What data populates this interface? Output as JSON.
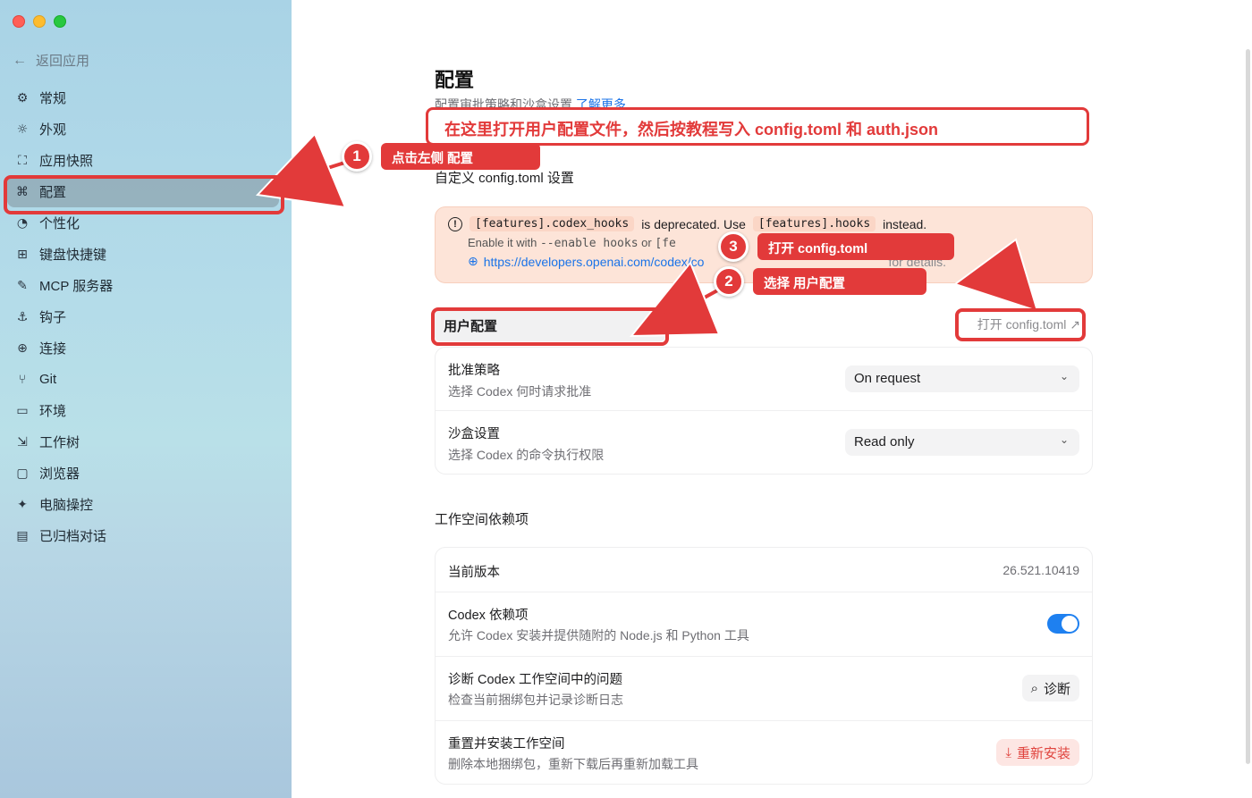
{
  "sidebar": {
    "back_label": "返回应用",
    "items": [
      {
        "label": "常规",
        "icon": "⚙"
      },
      {
        "label": "外观",
        "icon": "☼"
      },
      {
        "label": "应用快照",
        "icon": "⛶"
      },
      {
        "label": "配置",
        "icon": "⌘"
      },
      {
        "label": "个性化",
        "icon": "◔"
      },
      {
        "label": "键盘快捷键",
        "icon": "⊞"
      },
      {
        "label": "MCP 服务器",
        "icon": "✎"
      },
      {
        "label": "钩子",
        "icon": "⚓"
      },
      {
        "label": "连接",
        "icon": "⊕"
      },
      {
        "label": "Git",
        "icon": "⑂"
      },
      {
        "label": "环境",
        "icon": "▭"
      },
      {
        "label": "工作树",
        "icon": "⇲"
      },
      {
        "label": "浏览器",
        "icon": "▢"
      },
      {
        "label": "电脑操控",
        "icon": "✦"
      },
      {
        "label": "已归档对话",
        "icon": "▤"
      }
    ]
  },
  "main": {
    "title": "配置",
    "subtitle": "配置审批策略和沙盒设置",
    "learn_more": "了解更多",
    "custom_section": "自定义 config.toml 设置",
    "warning": {
      "code1": "[features].codex_hooks",
      "text1": "is deprecated. Use",
      "code2": "[features].hooks",
      "text2": "instead.",
      "line2_prefix": "Enable it with",
      "line2_code": "--enable hooks",
      "line2_mid": "or",
      "line2_code2": "[fe",
      "link": "https://developers.openai.com/codex/co",
      "link_tail": "for details."
    },
    "user_config_tab": "用户配置",
    "open_config": "打开 config.toml ↗",
    "approval": {
      "title": "批准策略",
      "desc": "选择 Codex 何时请求批准",
      "value": "On request"
    },
    "sandbox": {
      "title": "沙盒设置",
      "desc": "选择 Codex 的命令执行权限",
      "value": "Read only"
    },
    "workspace_section": "工作空间依赖项",
    "version": {
      "title": "当前版本",
      "value": "26.521.10419"
    },
    "deps": {
      "title": "Codex 依赖项",
      "desc": "允许 Codex 安装并提供随附的 Node.js 和 Python 工具",
      "enabled": true
    },
    "diagnose": {
      "title": "诊断 Codex 工作空间中的问题",
      "desc": "检查当前捆绑包并记录诊断日志",
      "button": "诊断"
    },
    "reinstall": {
      "title": "重置并安装工作空间",
      "desc": "删除本地捆绑包，重新下载后再重新加载工具",
      "button": "重新安装"
    }
  },
  "annotations": {
    "top_banner": "在这里打开用户配置文件，然后按教程写入 config.toml 和 auth.json",
    "step1": {
      "num": "1",
      "text": "点击左侧 配置"
    },
    "step2": {
      "num": "2",
      "text": "选择 用户配置"
    },
    "step3": {
      "num": "3",
      "text": "打开 config.toml"
    },
    "color": "#e23a3a"
  }
}
